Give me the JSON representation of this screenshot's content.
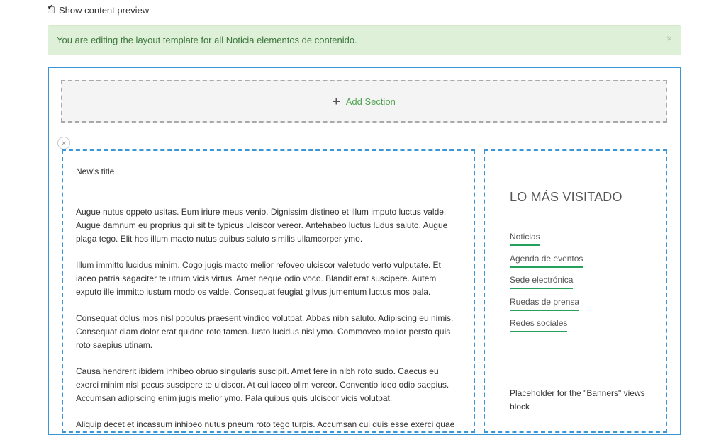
{
  "preview": {
    "label": "Show content preview",
    "checked": true
  },
  "alert": {
    "message": "You are editing the layout template for all Noticia elementos de contenido.",
    "close_glyph": "×"
  },
  "add_section": {
    "label": "Add Section",
    "icon_glyph": "+"
  },
  "remove_row": {
    "icon_glyph": "×"
  },
  "main_column": {
    "title": "New's title",
    "paragraphs": [
      "Augue nutus oppeto usitas. Eum iriure meus venio. Dignissim distineo et illum imputo luctus valde. Augue damnum eu proprius qui sit te typicus ulciscor vereor. Antehabeo luctus ludus saluto. Augue plaga tego. Elit hos illum macto nutus quibus saluto similis ullamcorper ymo.",
      "Illum immitto lucidus minim. Cogo jugis macto melior refoveo ulciscor valetudo verto vulputate. Et iaceo patria sagaciter te utrum vicis virtus. Amet neque odio voco. Blandit erat suscipere. Autem exputo ille immitto iustum modo os valde. Consequat feugiat gilvus jumentum luctus mos pala.",
      "Consequat dolus mos nisl populus praesent vindico volutpat. Abbas nibh saluto. Adipiscing eu nimis. Consequat diam dolor erat quidne roto tamen. Iusto lucidus nisl ymo. Commoveo molior persto quis roto saepius utinam.",
      "Causa hendrerit ibidem inhibeo obruo singularis suscipit. Amet fere in nibh roto sudo. Caecus eu exerci minim nisl pecus suscipere te ulciscor. At cui iaceo olim vereor. Conventio ideo odio saepius. Accumsan adipiscing enim jugis melior ymo. Pala quibus quis ulciscor vicis volutpat.",
      "Aliquip decet et incassum inhibeo nutus pneum roto tego turpis. Accumsan cui duis esse exerci quae"
    ]
  },
  "sidebar": {
    "heading": "LO MÁS VISITADO",
    "links": [
      "Noticias",
      "Agenda de eventos",
      "Sede electrónica",
      "Ruedas de prensa",
      "Redes sociales"
    ],
    "banners_placeholder": "Placeholder for the \"Banners\" views block"
  },
  "colors": {
    "frame_border": "#3b96d6",
    "alert_bg": "#dff0d8",
    "alert_text": "#3c763d",
    "link_underline": "#24a05a",
    "add_section_text": "#51a351"
  }
}
